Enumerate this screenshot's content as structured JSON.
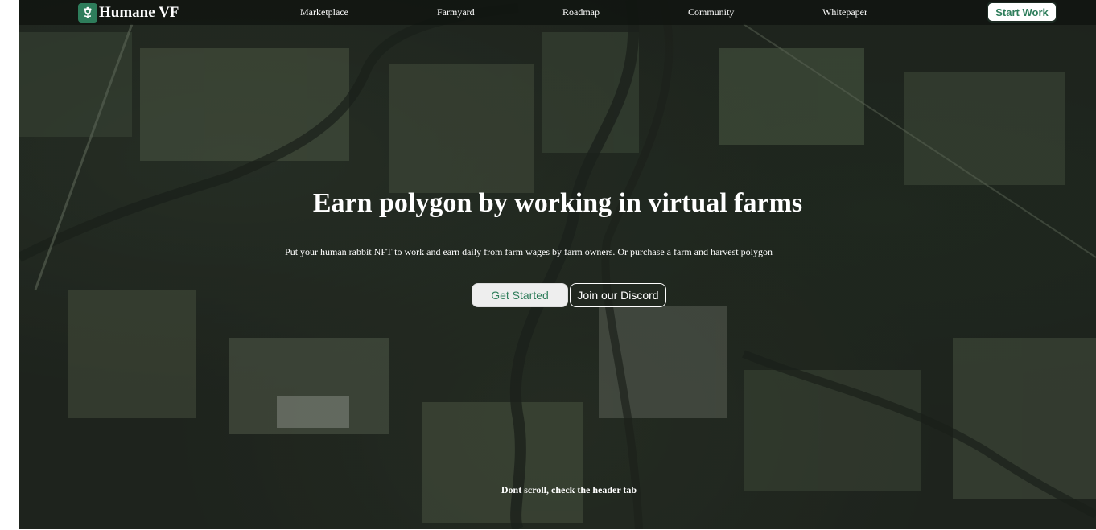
{
  "brand": {
    "name": "Humane VF",
    "icon": "plant-icon",
    "color": "#2e7d5b"
  },
  "nav": {
    "items": [
      {
        "label": "Marketplace"
      },
      {
        "label": "Farmyard"
      },
      {
        "label": "Roadmap"
      },
      {
        "label": "Community"
      },
      {
        "label": "Whitepaper"
      }
    ],
    "cta_label": "Start Work"
  },
  "hero": {
    "title": "Earn polygon by working in virtual farms",
    "subtitle": "Put your human rabbit NFT to work and earn daily from farm wages by farm owners. Or purchase a farm and harvest polygon",
    "primary_button": "Get Started",
    "secondary_button": "Join our Discord",
    "scroll_hint": "Dont scroll, check the header tab",
    "background": "aerial-farmland-image"
  }
}
